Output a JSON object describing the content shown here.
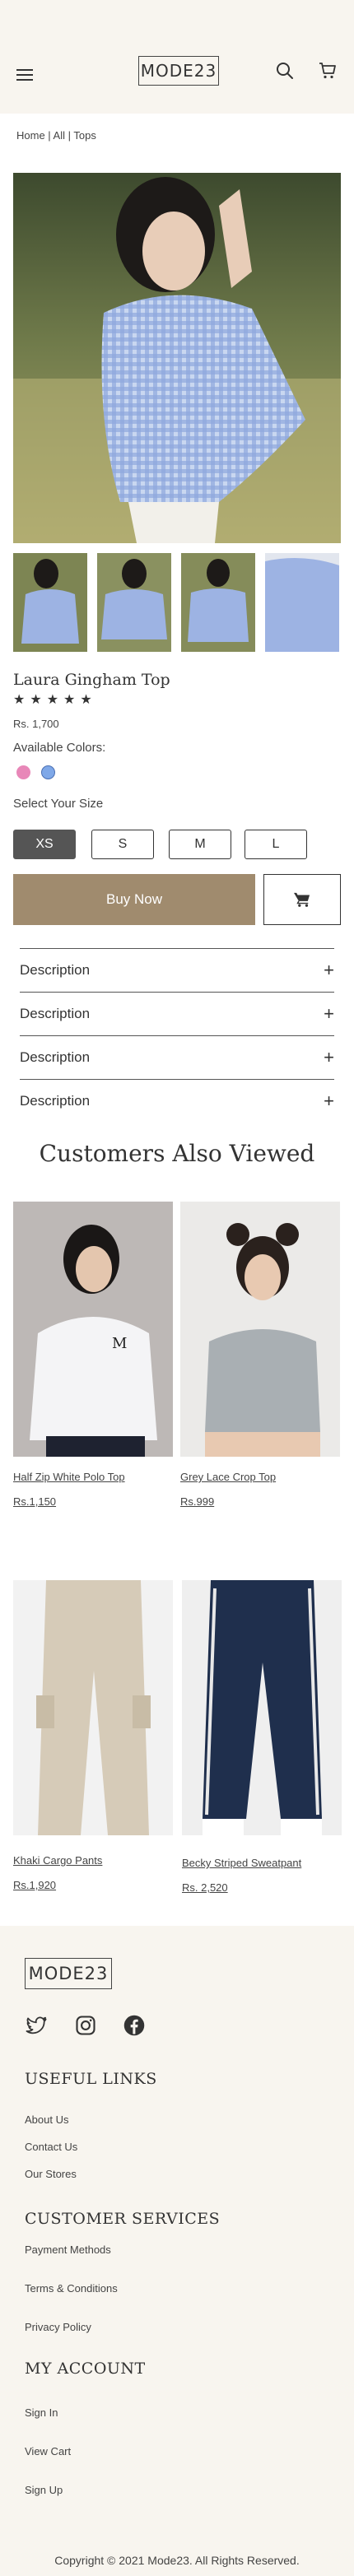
{
  "header": {
    "logo_text": "MODE23",
    "menu_icon": "hamburger-menu-icon",
    "search_icon": "search-icon",
    "cart_icon": "cart-icon"
  },
  "breadcrumb": "Home | All | Tops",
  "product": {
    "title": "Laura Gingham Top",
    "rating": 5,
    "price": "Rs. 1,700",
    "colors_label": "Available Colors:",
    "colors": [
      "#e887b8",
      "#7fa8e8"
    ],
    "size_label": "Select Your Size",
    "sizes": [
      "XS",
      "S",
      "M",
      "L"
    ],
    "selected_size": "XS",
    "buy_now_label": "Buy Now",
    "accent_color": "#a08b6e"
  },
  "accordions": [
    {
      "label": "Description"
    },
    {
      "label": "Description"
    },
    {
      "label": "Description"
    },
    {
      "label": "Description"
    }
  ],
  "also_viewed": {
    "title": "Customers Also Viewed",
    "items": [
      {
        "name": "Half Zip White Polo Top",
        "price": "Rs.1,150"
      },
      {
        "name": "Grey Lace Crop Top",
        "price": "Rs.999"
      },
      {
        "name": "Khaki Cargo Pants",
        "price": "Rs.1,920"
      },
      {
        "name": "Becky Striped Sweatpant",
        "price": "Rs. 2,520"
      }
    ]
  },
  "footer": {
    "logo_text": "MODE23",
    "social_icons": [
      "twitter-icon",
      "instagram-icon",
      "facebook-icon"
    ],
    "useful_links": {
      "heading": "USEFUL LINKS",
      "links": [
        "About Us",
        "Contact Us",
        "Our Stores"
      ]
    },
    "customer_services": {
      "heading": "CUSTOMER SERVICES",
      "links": [
        "Payment Methods",
        "Terms & Conditions",
        "Privacy Policy"
      ]
    },
    "my_account": {
      "heading": "MY ACCOUNT",
      "links": [
        "Sign In",
        "View Cart",
        "Sign Up"
      ]
    },
    "copyright": "Copyright © 2021 Mode23. All Rights Reserved."
  }
}
